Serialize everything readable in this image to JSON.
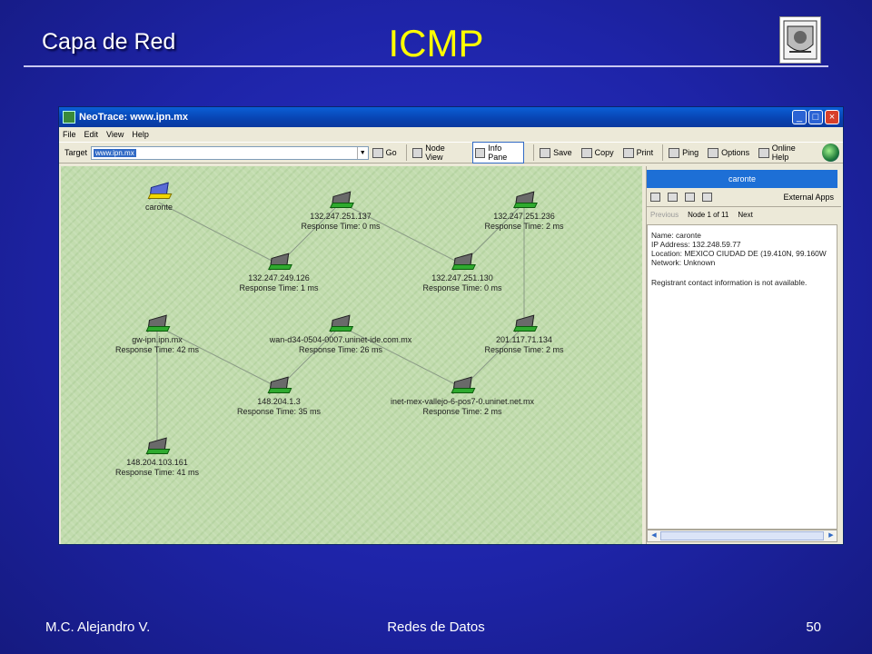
{
  "slide": {
    "subtitle": "Capa de Red",
    "title": "ICMP",
    "footer_left": "M.C. Alejandro V.",
    "footer_center": "Redes de Datos",
    "footer_right": "50",
    "colors": {
      "title": "#ffff00",
      "background": "#1e24a8"
    }
  },
  "window": {
    "title": "NeoTrace: www.ipn.mx",
    "menu": [
      "File",
      "Edit",
      "View",
      "Help"
    ],
    "toolbar": {
      "target_label": "Target",
      "target_value": "www.ipn.mx",
      "go": "Go",
      "node_view": "Node View",
      "info_pane": "Info Pane",
      "save": "Save",
      "copy": "Copy",
      "print": "Print",
      "ping": "Ping",
      "options": "Options",
      "online_help": "Online Help"
    }
  },
  "map": {
    "nodes": [
      {
        "name": "caronte",
        "response": "",
        "type": "pc"
      },
      {
        "name": "132.247.251.137",
        "response": "Response Time: 0 ms"
      },
      {
        "name": "132.247.251.236",
        "response": "Response Time: 2 ms"
      },
      {
        "name": "132.247.249.126",
        "response": "Response Time: 1 ms"
      },
      {
        "name": "132.247.251.130",
        "response": "Response Time: 0 ms"
      },
      {
        "name": "gw-ipn.ipn.mx",
        "response": "Response Time: 42 ms"
      },
      {
        "name": "wan-d34-0504-0007.uninet-ide.com.mx",
        "response": "Response Time: 26 ms"
      },
      {
        "name": "201.117.71.134",
        "response": "Response Time: 2 ms"
      },
      {
        "name": "148.204.1.3",
        "response": "Response Time: 35 ms"
      },
      {
        "name": "inet-mex-vallejo-6-pos7-0.uninet.net.mx",
        "response": "Response Time: 2 ms"
      },
      {
        "name": "148.204.103.161",
        "response": "Response Time: 41 ms"
      }
    ]
  },
  "info_pane": {
    "header": "caronte",
    "external_apps": "External Apps",
    "previous": "Previous",
    "node_of": "Node 1 of 11",
    "next": "Next",
    "lines": [
      "Name: caronte",
      "IP Address: 132.248.59.77",
      "Location: MEXICO CIUDAD DE (19.410N,  99.160W",
      "Network: Unknown"
    ],
    "registrant": "Registrant contact information is not available."
  }
}
